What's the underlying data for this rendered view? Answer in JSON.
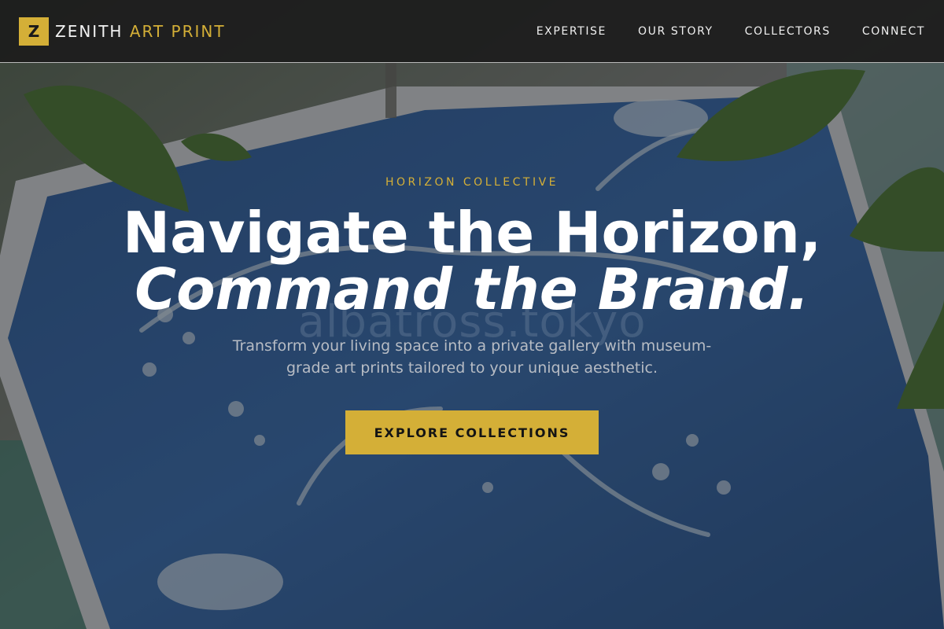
{
  "brand": {
    "mark": "Z",
    "name": "ZENITH",
    "accent": "ART PRINT",
    "accent_color": "#d4af37"
  },
  "nav": {
    "items": [
      "EXPERTISE",
      "OUR STORY",
      "COLLECTORS",
      "CONNECT"
    ]
  },
  "hero": {
    "eyebrow": "HORIZON COLLECTIVE",
    "title_line1": "Navigate the Horizon,",
    "title_line2": "Command the Brand.",
    "watermark": "albatross.tokyo",
    "subtitle": "Transform your living space into a private gallery with museum-grade art prints tailored to your unique aesthetic.",
    "cta_label": "EXPLORE COLLECTIONS",
    "cta_color": "#d4af37"
  }
}
